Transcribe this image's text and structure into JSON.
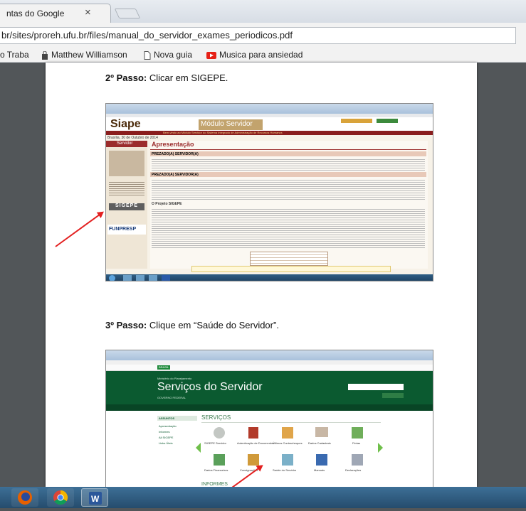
{
  "browser": {
    "tab_title": "ntas do Google",
    "tab_close": "×",
    "url": "br/sites/proreh.ufu.br/files/manual_do_servidor_exames_periodicos.pdf",
    "bookmarks": [
      {
        "label": "o Traba",
        "icon": "page-icon"
      },
      {
        "label": "Matthew Williamson",
        "icon": "bag-icon"
      },
      {
        "label": "Nova guia",
        "icon": "page-icon"
      },
      {
        "label": "Musica para ansiedad",
        "icon": "youtube-icon"
      }
    ]
  },
  "document": {
    "step2_bold": "2º Passo:",
    "step2_text": " Clicar em SIGEPE.",
    "step3_bold": "3º Passo:",
    "step3_text": " Clique em “Saúde do Servidor”.",
    "shot1": {
      "brand": "Siape",
      "brand_sub": "Sistema Integrado de Administração de Recursos Humanos",
      "module": "Módulo Servidor",
      "banner": "Bem-vindo ao Módulo Servidor do Sistema Integrado de Administração de Recursos Humanos",
      "sidebar_title": "Servidor",
      "main_title": "Apresentação",
      "section1": "PREZADO(A) SERVIDOR(A)",
      "section2": "PREZADO(A) SERVIDOR(A)",
      "section3": "O Projeto SIGEPE",
      "sigepe": "SIGEPE",
      "funpresp": "FUNPRESP",
      "date": "Brasília, 30 de Outubro de 2014"
    },
    "shot2": {
      "ministry": "Ministério do Planejamento",
      "title": "Serviços do Servidor",
      "subtitle": "GOVERNO FEDERAL",
      "brasil": "BRASIL",
      "services_label": "SERVIÇOS",
      "informes_label": "INFORMES",
      "left_menu_title": "ASSUNTOS",
      "left_menu": [
        "Apresentação",
        "Informes",
        "Ali SIGEPE",
        "Links Úteis"
      ],
      "services": [
        "SIGEPE Servidor",
        "Autenticação de Documentos",
        "Últimos Contracheques",
        "Dados Cadastrais",
        "Férias",
        "Dados Financeiros",
        "Consignações",
        "Saúde do Servidor",
        "Manuais",
        "Declarações"
      ]
    }
  },
  "taskbar": {
    "apps": [
      "firefox-icon",
      "chrome-icon",
      "word-icon"
    ]
  }
}
